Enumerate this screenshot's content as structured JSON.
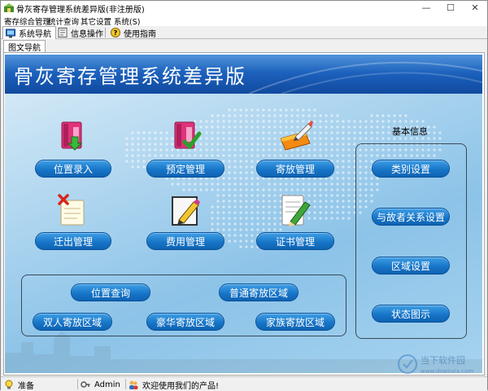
{
  "window": {
    "title": "骨灰寄存管理系统差异版(非注册版)",
    "minimize_glyph": "—",
    "maximize_glyph": "☐",
    "close_glyph": "✕"
  },
  "menu": {
    "items": [
      "寄存综合管理",
      "统计查询",
      "其它设置",
      "系统(S)"
    ]
  },
  "tabs": {
    "items": [
      {
        "label": "系统导航",
        "icon": "monitor-icon"
      },
      {
        "label": "信息操作",
        "icon": "form-icon"
      },
      {
        "label": "使用指南",
        "icon": "help-icon"
      }
    ]
  },
  "subtab": {
    "label": "图文导航"
  },
  "banner": {
    "title": "骨灰寄存管理系统差异版"
  },
  "nav": {
    "register": "位置录入",
    "reserve": "预定管理",
    "deposit": "寄放管理",
    "moveout": "迁出管理",
    "fees": "费用管理",
    "certificate": "证书管理"
  },
  "query": {
    "location_query": "位置查询",
    "normal_area": "普通寄放区域",
    "double_area": "双人寄放区域",
    "luxury_area": "豪华寄放区域",
    "family_area": "家族寄放区域"
  },
  "basic_info": {
    "heading": "基本信息",
    "category": "类别设置",
    "relation": "与故者关系设置",
    "area": "区域设置",
    "status_chart": "状态图示"
  },
  "status": {
    "state": "准备",
    "user": "Admin",
    "message": "欢迎使用我们的产品!"
  },
  "watermark": {
    "text_cn": "当下软件园",
    "text_en": "www.downxia.com"
  },
  "colors": {
    "banner": "#1a5db8",
    "button": "#1876c8",
    "stage": "#a8d2ee"
  }
}
